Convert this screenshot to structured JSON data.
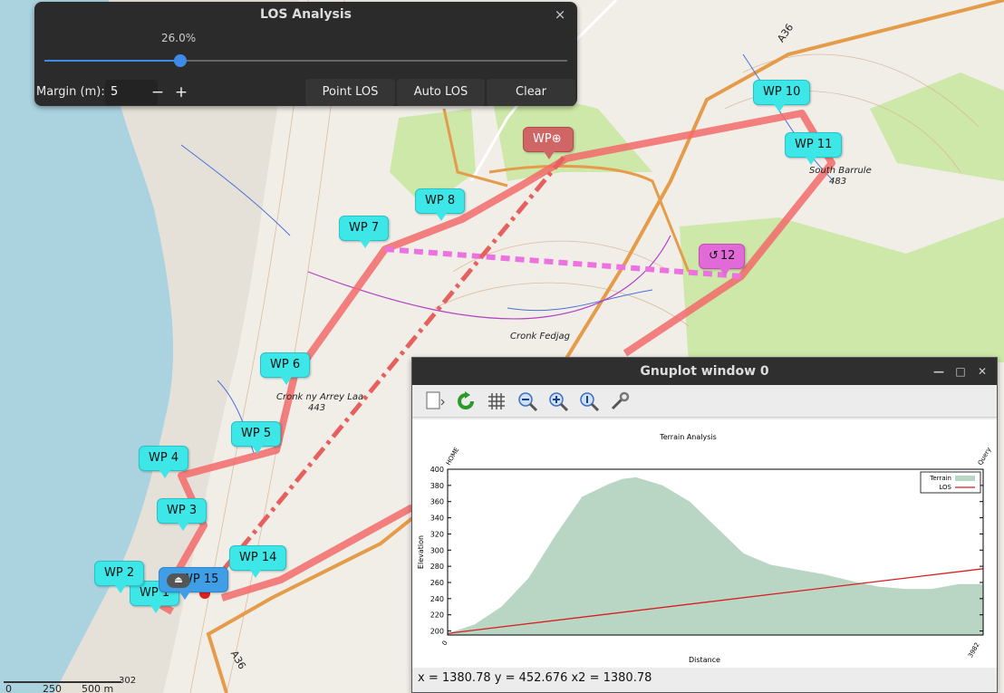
{
  "map": {
    "labels": {
      "south_barrule": "South Barrule",
      "south_barrule_height": "483",
      "cronk_fedjag": "Cronk Fedjag",
      "cronk_ny_arrey_laa": "Cronk ny Arrey Laa",
      "cronk_height": "443",
      "road_a36_top": "A36",
      "road_a36_bottom": "A36",
      "spot_302": "302"
    },
    "scale": {
      "zero": "0",
      "s250": "250",
      "s500": "500 m"
    },
    "waypoints": [
      {
        "label": "WP 1"
      },
      {
        "label": "WP 2"
      },
      {
        "label": "WP 3"
      },
      {
        "label": "WP 4"
      },
      {
        "label": "WP 5"
      },
      {
        "label": "WP 6"
      },
      {
        "label": "WP 7"
      },
      {
        "label": "WP 8"
      },
      {
        "label": "WP"
      },
      {
        "label": "WP 10"
      },
      {
        "label": "WP 11"
      },
      {
        "label": "12"
      },
      {
        "label": "WP 14"
      },
      {
        "label": "WP 15"
      }
    ],
    "colors": {
      "route": "#f26a6a",
      "los_line": "#e5605e",
      "magenta_link": "#ec72e0",
      "water": "#aad3df",
      "wood": "#cde8a8"
    }
  },
  "los_window": {
    "title": "LOS Analysis",
    "close": "×",
    "percent_label": "26.0%",
    "slider_value": 0.26,
    "margin_label": "Margin (m):",
    "margin_value": "5",
    "minus": "−",
    "plus": "+",
    "buttons": {
      "point": "Point LOS",
      "auto": "Auto LOS",
      "clear": "Clear"
    }
  },
  "gnuplot_window": {
    "title": "Gnuplot window 0",
    "controls": {
      "minimize": "—",
      "maximize": "□",
      "close": "✕"
    },
    "toolbar_icons": [
      "export-icon",
      "replot-icon",
      "grid-icon",
      "zoom-out-icon",
      "zoom-in-icon",
      "zoom-reset-icon",
      "settings-icon"
    ],
    "status": "x = 1380.78 y = 452.676 x2 = 1380.78"
  },
  "chart_data": {
    "type": "area",
    "title": "Terrain Analysis",
    "xlabel": "Distance",
    "ylabel": "Elevation",
    "top_labels": {
      "left": "HOME",
      "right": "Query"
    },
    "x_tick_labels": [
      "0",
      "3982"
    ],
    "xlim": [
      0,
      3982
    ],
    "ylim": [
      195,
      400
    ],
    "yticks": [
      200,
      220,
      240,
      260,
      280,
      300,
      320,
      340,
      360,
      380,
      400
    ],
    "legend_position": "top-right",
    "series": [
      {
        "name": "Terrain",
        "kind": "area",
        "color": "#b9d6c4",
        "x": [
          0,
          200,
          400,
          600,
          800,
          1000,
          1200,
          1300,
          1400,
          1600,
          1800,
          2000,
          2200,
          2400,
          2600,
          2800,
          3000,
          3200,
          3400,
          3600,
          3800,
          3982
        ],
        "y": [
          197,
          208,
          230,
          265,
          318,
          366,
          382,
          388,
          390,
          380,
          360,
          328,
          296,
          282,
          276,
          270,
          262,
          255,
          252,
          252,
          258,
          258
        ]
      },
      {
        "name": "LOS",
        "kind": "line",
        "color": "#d81e1e",
        "x": [
          0,
          3982
        ],
        "y": [
          197,
          277
        ]
      }
    ]
  }
}
